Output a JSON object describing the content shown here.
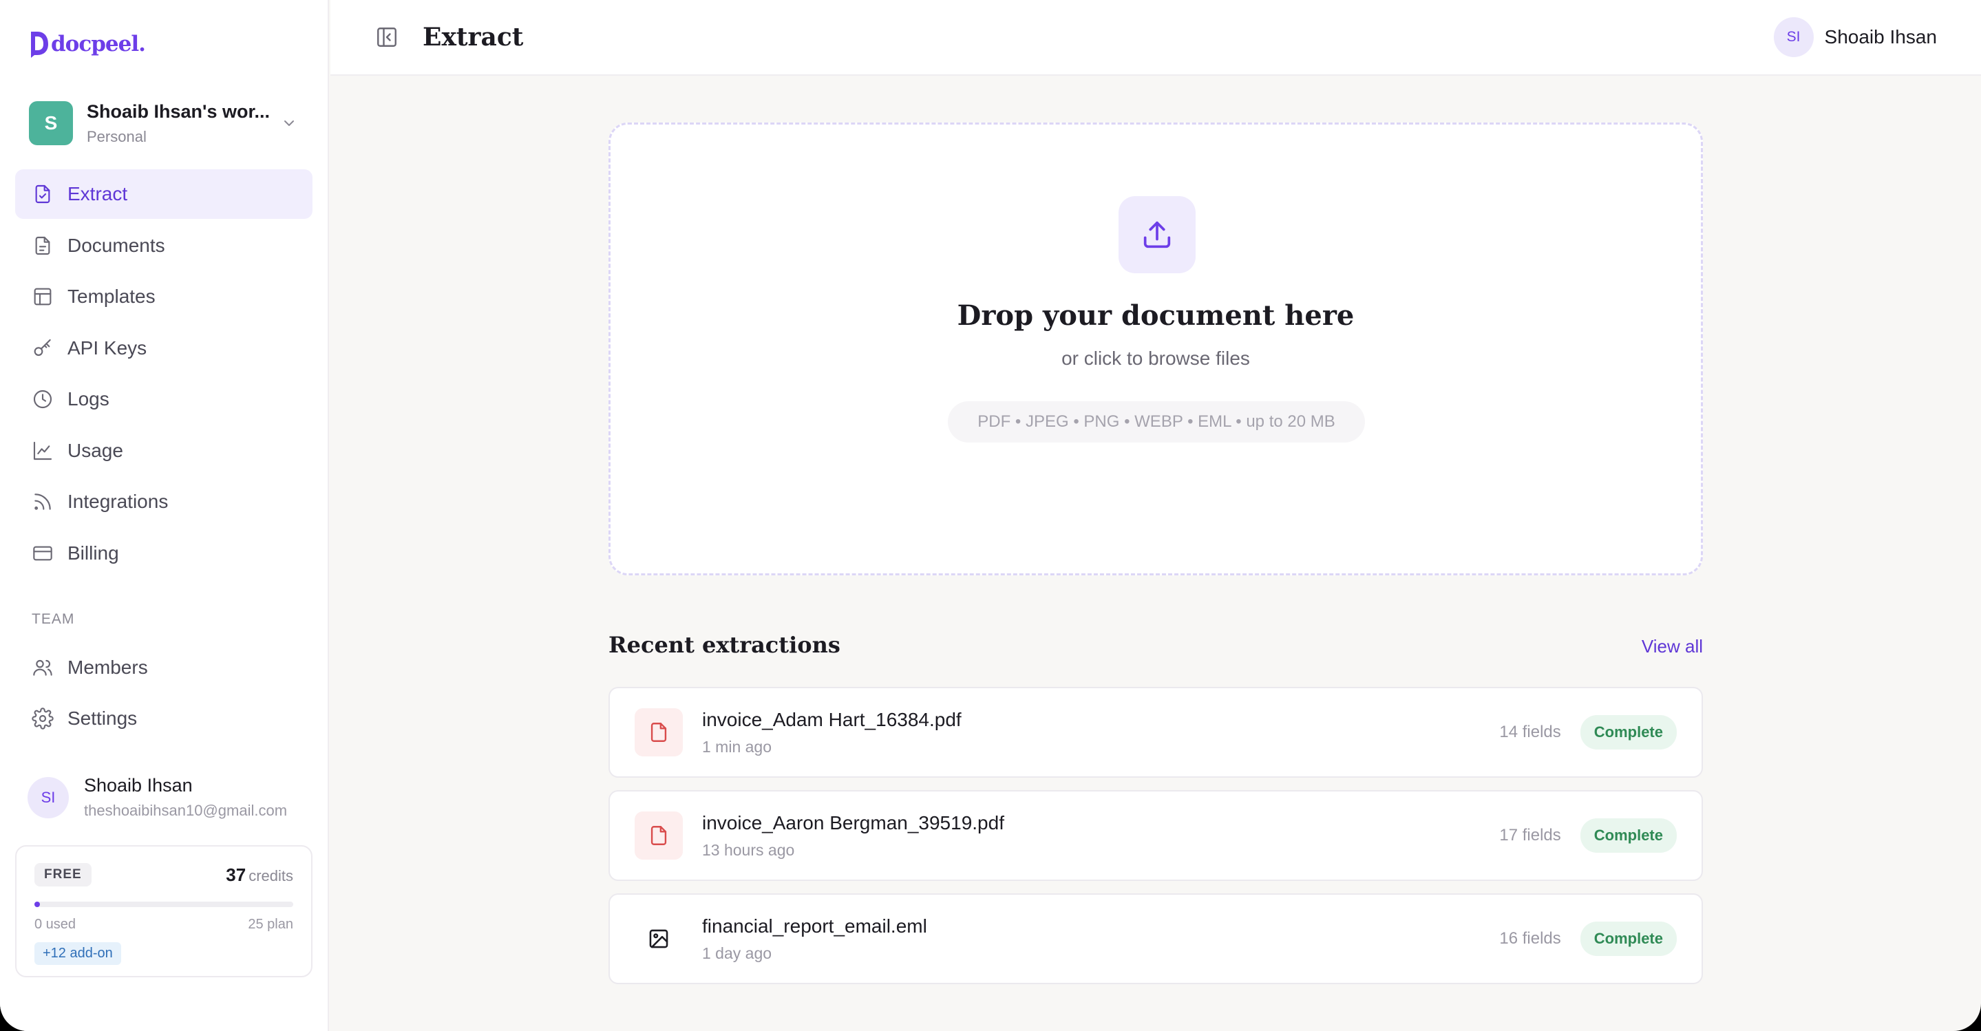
{
  "brand": {
    "name": "docpeel.",
    "accent": "#6d3ee8"
  },
  "workspace": {
    "initial": "S",
    "name": "Shoaib Ihsan's wor...",
    "type": "Personal"
  },
  "nav": {
    "items": [
      {
        "label": "Extract",
        "icon": "document-check-icon",
        "active": true
      },
      {
        "label": "Documents",
        "icon": "document-icon"
      },
      {
        "label": "Templates",
        "icon": "layout-icon"
      },
      {
        "label": "API Keys",
        "icon": "key-icon"
      },
      {
        "label": "Logs",
        "icon": "clock-icon"
      },
      {
        "label": "Usage",
        "icon": "chart-icon"
      },
      {
        "label": "Integrations",
        "icon": "rss-icon"
      },
      {
        "label": "Billing",
        "icon": "credit-card-icon"
      }
    ],
    "team_section": "TEAM",
    "team_items": [
      {
        "label": "Members",
        "icon": "users-icon"
      },
      {
        "label": "Settings",
        "icon": "gear-icon"
      }
    ]
  },
  "user": {
    "initials": "SI",
    "name": "Shoaib Ihsan",
    "email": "theshoaibihsan10@gmail.com"
  },
  "credits": {
    "plan": "FREE",
    "count": "37",
    "unit": "credits",
    "used_label": "0 used",
    "plan_label": "25 plan",
    "used_fraction": 0.0,
    "addon": "+12 add-on"
  },
  "header": {
    "title": "Extract",
    "user_initials": "SI",
    "user_name": "Shoaib Ihsan"
  },
  "dropzone": {
    "title": "Drop your document here",
    "subtitle": "or click to browse files",
    "formats": "PDF  •  JPEG  •  PNG  •  WEBP  •  EML  •  up to 20 MB"
  },
  "recent": {
    "title": "Recent extractions",
    "view_all": "View all",
    "items": [
      {
        "name": "invoice_Adam Hart_16384.pdf",
        "time": "1 min ago",
        "fields": "14 fields",
        "status": "Complete",
        "kind": "pdf"
      },
      {
        "name": "invoice_Aaron Bergman_39519.pdf",
        "time": "13 hours ago",
        "fields": "17 fields",
        "status": "Complete",
        "kind": "pdf"
      },
      {
        "name": "financial_report_email.eml",
        "time": "1 day ago",
        "fields": "16 fields",
        "status": "Complete",
        "kind": "image"
      }
    ]
  }
}
